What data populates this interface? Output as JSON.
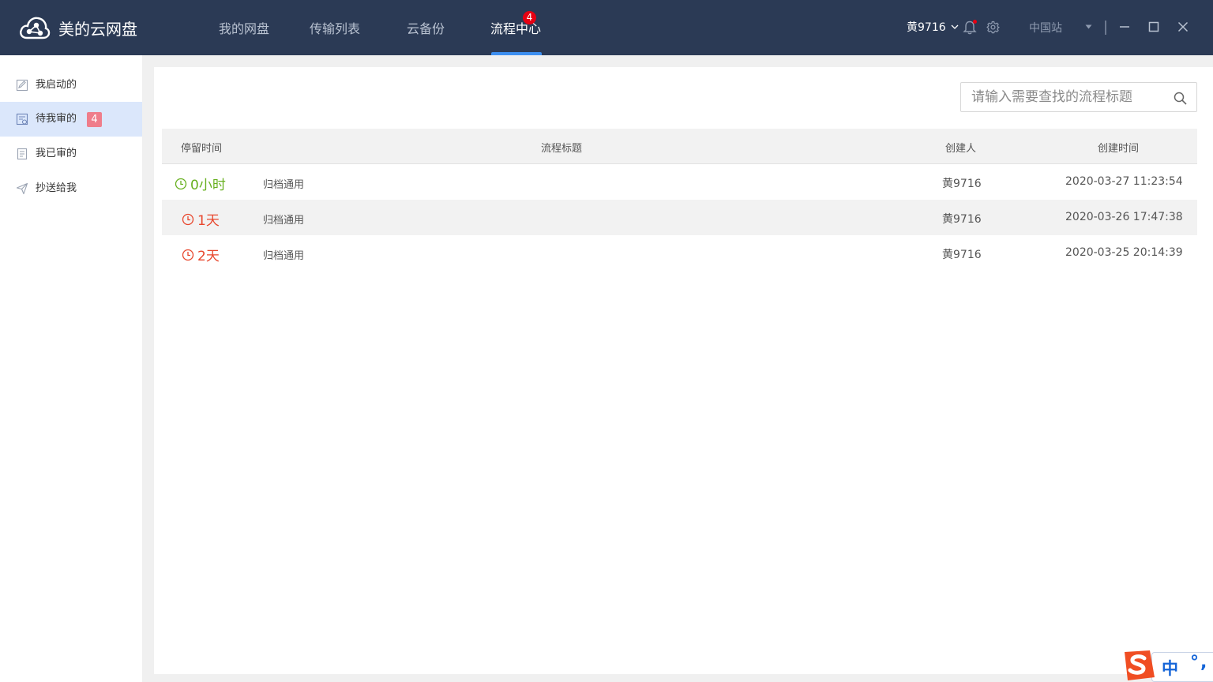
{
  "app": {
    "name": "美的云网盘",
    "tabs": [
      {
        "label": "我的网盘",
        "active": false
      },
      {
        "label": "传输列表",
        "active": false
      },
      {
        "label": "云备份",
        "active": false
      },
      {
        "label": "流程中心",
        "active": true,
        "badge": "4"
      }
    ],
    "user": {
      "name": "黄9716"
    },
    "site": {
      "label": "中国站"
    }
  },
  "sidebar": {
    "items": [
      {
        "label": "我启动的",
        "icon": "edit-doc-icon",
        "active": false
      },
      {
        "label": "待我审的",
        "icon": "pending-doc-icon",
        "active": true,
        "badge": "4"
      },
      {
        "label": "我已审的",
        "icon": "checked-doc-icon",
        "active": false
      },
      {
        "label": "抄送给我",
        "icon": "send-icon",
        "active": false
      }
    ]
  },
  "search": {
    "placeholder": "请输入需要查找的流程标题"
  },
  "table": {
    "headers": {
      "duration": "停留时间",
      "title": "流程标题",
      "creator": "创建人",
      "created": "创建时间"
    },
    "rows": [
      {
        "duration": "0小时",
        "duration_status": "recent",
        "title": "归档通用",
        "creator": "黄9716",
        "created": "2020-03-27 11:23:54"
      },
      {
        "duration": "1天",
        "duration_status": "overdue",
        "title": "归档通用",
        "creator": "黄9716",
        "created": "2020-03-26 17:47:38"
      },
      {
        "duration": "2天",
        "duration_status": "overdue",
        "title": "归档通用",
        "creator": "黄9716",
        "created": "2020-03-25 20:14:39"
      }
    ]
  },
  "ime": {
    "lang": "中",
    "punct": "°,"
  },
  "colors": {
    "topbar": "#2b3a55",
    "accent": "#3d8ff0",
    "recent": "#67b01f",
    "overdue": "#e8472d",
    "badge": "#e60012",
    "sidebar_badge": "#ef7d8b"
  }
}
